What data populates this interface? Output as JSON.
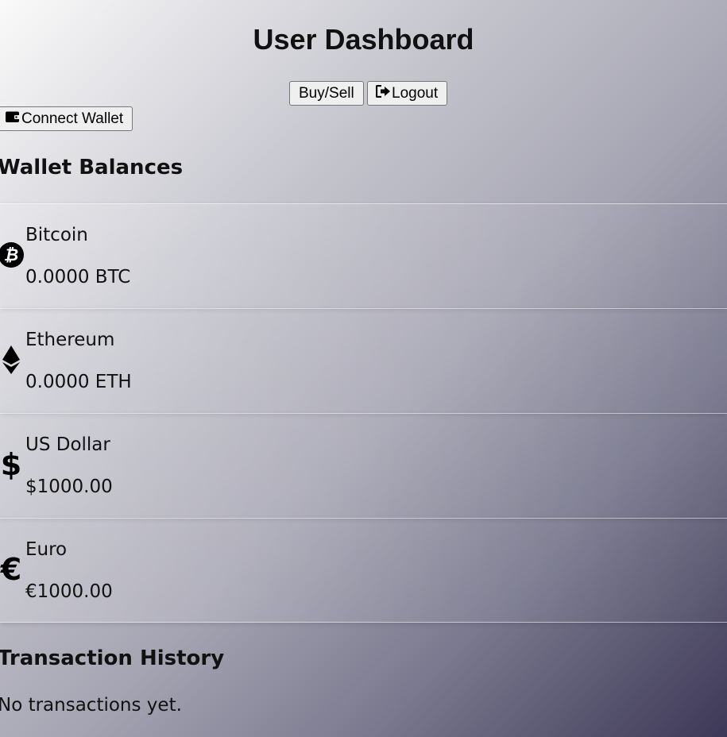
{
  "page": {
    "title": "User Dashboard"
  },
  "header": {
    "buy_sell_label": "Buy/Sell",
    "logout_label": "Logout",
    "connect_wallet_label": "Connect Wallet"
  },
  "wallet": {
    "heading": "Wallet Balances",
    "items": [
      {
        "name": "Bitcoin",
        "amount": "0.0000 BTC",
        "icon": "bitcoin-icon"
      },
      {
        "name": "Ethereum",
        "amount": "0.0000 ETH",
        "icon": "ethereum-icon"
      },
      {
        "name": "US Dollar",
        "amount": "$1000.00",
        "icon": "dollar-icon"
      },
      {
        "name": "Euro",
        "amount": "€1000.00",
        "icon": "euro-icon"
      }
    ]
  },
  "transactions": {
    "heading": "Transaction History",
    "empty_text": "No transactions yet."
  },
  "colors": {
    "gradient_start": "#fafafa",
    "gradient_end": "#3d3857",
    "button_bg": "#efefef"
  }
}
